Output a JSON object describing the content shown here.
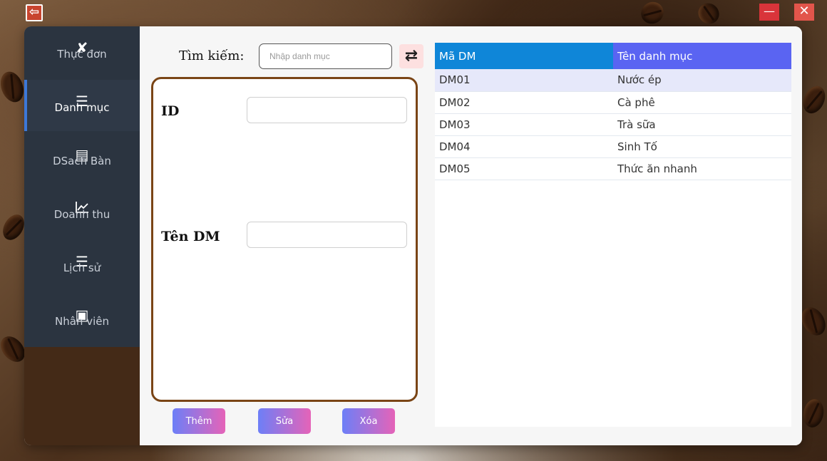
{
  "titlebar": {
    "logo_icon": "logout-icon",
    "minimize_label": "—",
    "close_label": "✕"
  },
  "sidebar": {
    "items": [
      {
        "label": "Thực đơn",
        "icon": "utensils-icon",
        "glyph": "✘"
      },
      {
        "label": "Danh mục",
        "icon": "list-icon",
        "glyph": "☰"
      },
      {
        "label": "DSach Bàn",
        "icon": "clipboard-icon",
        "glyph": "▤"
      },
      {
        "label": "Doanh thu",
        "icon": "chart-line-icon",
        "glyph": "📈"
      },
      {
        "label": "Lịch sử",
        "icon": "list-icon",
        "glyph": "☰"
      },
      {
        "label": "Nhân viên",
        "icon": "id-card-icon",
        "glyph": "▣"
      }
    ],
    "active_index": 1
  },
  "search": {
    "label": "Tìm kiếm:",
    "placeholder": "Nhập danh mục",
    "value": "",
    "refresh_icon": "refresh-icon"
  },
  "form": {
    "id_label": "ID",
    "id_value": "",
    "name_label": "Tên DM",
    "name_value": ""
  },
  "buttons": {
    "add": "Thêm",
    "edit": "Sửa",
    "delete": "Xóa"
  },
  "table": {
    "headers": [
      "Mã DM",
      "Tên danh mục"
    ],
    "rows": [
      [
        "DM01",
        "Nước ép"
      ],
      [
        "DM02",
        "Cà phê"
      ],
      [
        "DM03",
        "Trà sữa"
      ],
      [
        "DM04",
        "Sinh Tố"
      ],
      [
        "DM05",
        "Thức ăn nhanh"
      ]
    ],
    "selected_row": 0
  },
  "colors": {
    "sidebar": "#2b3440",
    "accent_blue": "#0f86d8",
    "header_purple": "#5a64f2",
    "form_border": "#7a4516"
  }
}
